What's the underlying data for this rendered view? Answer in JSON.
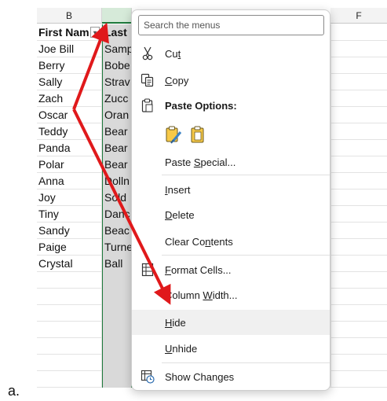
{
  "sheet": {
    "col_b": "B",
    "col_f": "F",
    "header_b": "First Nam",
    "header_c": "Last",
    "rows": [
      {
        "b": "Joe Bill",
        "c": "Samp"
      },
      {
        "b": "Berry",
        "c": "Bobe"
      },
      {
        "b": "Sally",
        "c": "Strav"
      },
      {
        "b": "Zach",
        "c": "Zucc"
      },
      {
        "b": "Oscar",
        "c": "Oran"
      },
      {
        "b": "Teddy",
        "c": "Bear"
      },
      {
        "b": "Panda",
        "c": "Bear"
      },
      {
        "b": "Polar",
        "c": "Bear"
      },
      {
        "b": "Anna",
        "c": "Dolln"
      },
      {
        "b": "Joy",
        "c": "Sold"
      },
      {
        "b": "Tiny",
        "c": "Danc"
      },
      {
        "b": "Sandy",
        "c": "Beac"
      },
      {
        "b": "Paige",
        "c": "Turne"
      },
      {
        "b": "Crystal",
        "c": "Ball"
      }
    ]
  },
  "menu": {
    "search_placeholder": "Search the menus",
    "cut": {
      "pre": "Cu",
      "key": "t",
      "post": ""
    },
    "copy": {
      "pre": "",
      "key": "C",
      "post": "opy"
    },
    "paste_options": "Paste Options:",
    "paste_special": {
      "pre": "Paste ",
      "key": "S",
      "post": "pecial..."
    },
    "insert": {
      "pre": "",
      "key": "I",
      "post": "nsert"
    },
    "delete": {
      "pre": "",
      "key": "D",
      "post": "elete"
    },
    "clear_contents": {
      "pre": "Clear Co",
      "key": "n",
      "post": "tents"
    },
    "format_cells": {
      "pre": "",
      "key": "F",
      "post": "ormat Cells..."
    },
    "column_width": {
      "pre": "Column ",
      "key": "W",
      "post": "idth..."
    },
    "hide": {
      "pre": "",
      "key": "H",
      "post": "ide"
    },
    "unhide": {
      "pre": "",
      "key": "U",
      "post": "nhide"
    },
    "show_changes": "Show Changes"
  },
  "figure_label": "a.",
  "colors": {
    "arrow": "#e0191b",
    "selected_col": "#d9d9d9",
    "selection_border": "#1f7a3d",
    "hover": "#f0f0f0"
  }
}
